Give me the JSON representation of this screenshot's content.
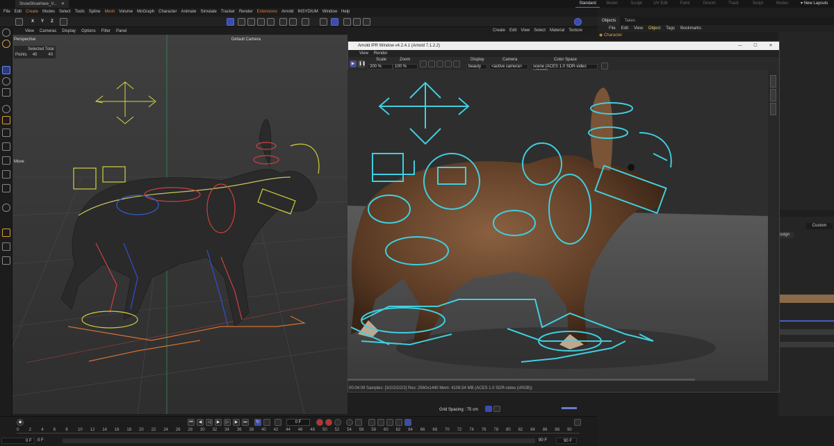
{
  "topbar": {
    "doc_tab": "SnowShoeHare_V...",
    "layout_tabs": [
      "Standard",
      "Model",
      "Sculpt",
      "UV Edit",
      "Paint",
      "Groom",
      "Track",
      "Script",
      "Nodes"
    ],
    "active_layout": "Standard",
    "new_layouts": "New Layouts"
  },
  "menubar": [
    "File",
    "Edit",
    "Create",
    "Modes",
    "Select",
    "Tools",
    "Spline",
    "Mesh",
    "Volume",
    "MoGraph",
    "Character",
    "Animate",
    "Simulate",
    "Tracker",
    "Render",
    "Extensions",
    "Arnold",
    "INSYDIUM",
    "Window",
    "Help"
  ],
  "toolbar": {
    "axes": [
      "X",
      "Y",
      "Z"
    ]
  },
  "viewport": {
    "menu": [
      "View",
      "Cameras",
      "Display",
      "Options",
      "Filter",
      "Panel"
    ],
    "name": "Perspective",
    "camera": "Default Camera",
    "hud_header": "Selected Total",
    "hud_label": "Points",
    "hud_values": [
      "40",
      "40"
    ],
    "tool_label": "Move"
  },
  "material_menu": [
    "Create",
    "Edit",
    "View",
    "Select",
    "Material",
    "Texture"
  ],
  "ipr": {
    "title": "Arnold IPR Window v4.2.4.1 (Arnold 7.1.2.2)",
    "menu": [
      "View",
      "Render"
    ],
    "scale_label": "Scale",
    "scale_value": "200 %",
    "zoom_label": "Zoom",
    "zoom_value": "100 %",
    "display_label": "Display",
    "display_value": "beauty",
    "camera_label": "Camera",
    "camera_value": "<active camera>",
    "colorspace_label": "Color Space",
    "colorspace_value": "scene (ACES 1.0 SDR-video (sRGB))",
    "status": "00:04:09  Samples: [3/2/2/2/2/2]  Res: 2560x1440  Mem: 4108.54 MB  (ACES 1.0 SDR-video (sRGB))"
  },
  "objects_panel": {
    "tabs": [
      "Objects",
      "Takes"
    ],
    "menu": [
      "File",
      "Edit",
      "View",
      "Object",
      "Tags",
      "Bookmarks"
    ],
    "active_menu": "Object",
    "first_item": "Character"
  },
  "attributes": {
    "custom": "Custom",
    "assign": "ssign"
  },
  "grid_spacing": "Grid Spacing : 75 cm",
  "timeline": {
    "current_frame": "0 F",
    "start": "0 F",
    "start2": "0 F",
    "end": "90 F",
    "end2": "90 F",
    "ticks": [
      "0",
      "2",
      "4",
      "6",
      "8",
      "10",
      "12",
      "14",
      "16",
      "18",
      "20",
      "22",
      "24",
      "26",
      "28",
      "30",
      "32",
      "34",
      "36",
      "38",
      "40",
      "42",
      "44",
      "46",
      "48",
      "50",
      "52",
      "54",
      "56",
      "58",
      "60",
      "62",
      "64",
      "66",
      "68",
      "70",
      "72",
      "74",
      "76",
      "78",
      "80",
      "82",
      "84",
      "86",
      "88",
      "90"
    ]
  },
  "colors": {
    "accent": "#5a6ec8",
    "ipr_gizmo": "#3fd0e0",
    "highlight": "#e08040"
  }
}
